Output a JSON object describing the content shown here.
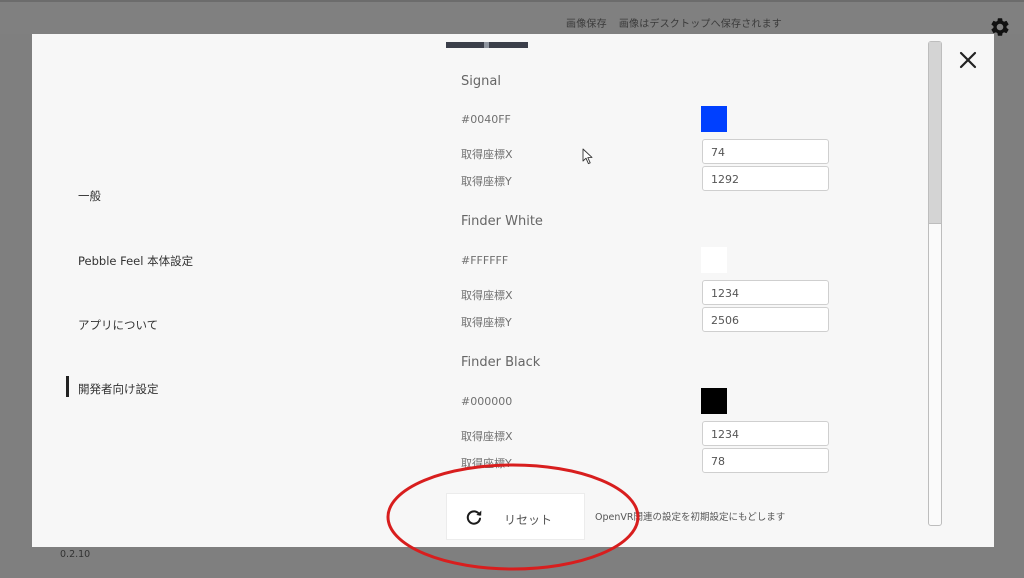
{
  "topbar": {
    "capture_label": "画像保存",
    "capture_message": "画像はデスクトップへ保存されます"
  },
  "nav": {
    "items": [
      {
        "label": "一般"
      },
      {
        "label": "Pebble Feel 本体設定"
      },
      {
        "label": "アプリについて"
      },
      {
        "label": "開発者向け設定",
        "active": true
      }
    ]
  },
  "sections": [
    {
      "title": "Signal",
      "color_label": "#0040FF",
      "color": "#0040FF",
      "x_label": "取得座標X",
      "x_value": "74",
      "y_label": "取得座標Y",
      "y_value": "1292"
    },
    {
      "title": "Finder White",
      "color_label": "#FFFFFF",
      "color": "#FFFFFF",
      "x_label": "取得座標X",
      "x_value": "1234",
      "y_label": "取得座標Y",
      "y_value": "2506"
    },
    {
      "title": "Finder Black",
      "color_label": "#000000",
      "color": "#000000",
      "x_label": "取得座標X",
      "x_value": "1234",
      "y_label": "取得座標Y",
      "y_value": "78"
    }
  ],
  "reset": {
    "label": "リセット",
    "description": "OpenVR関連の設定を初期設定にもどします"
  },
  "version": "0.2.10",
  "icons": {
    "settings": "gear-icon",
    "close": "close-icon",
    "reset": "refresh-icon",
    "pointer": "mouse-cursor-icon"
  },
  "annotation_color": "#D81E1E"
}
